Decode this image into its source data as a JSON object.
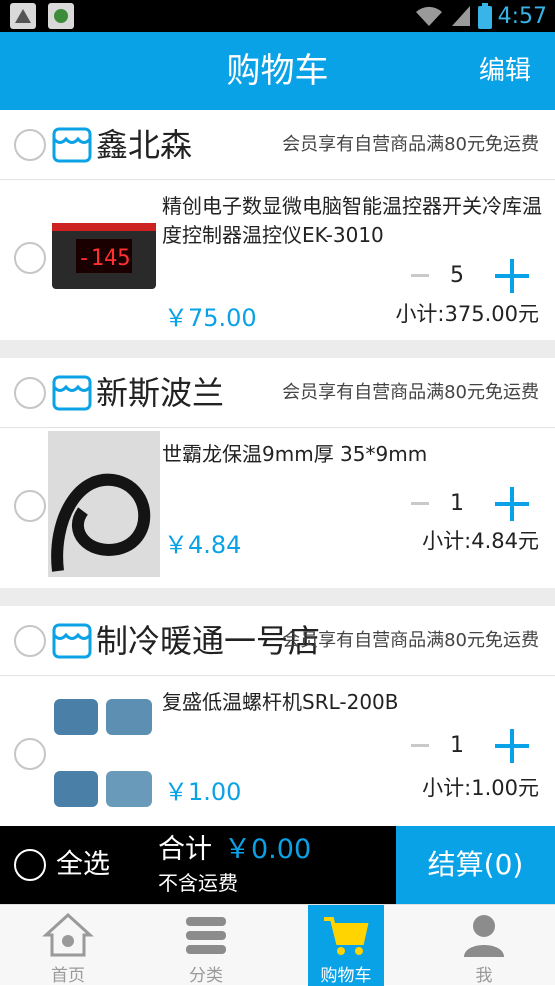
{
  "status_bar": {
    "time": "4:57"
  },
  "header": {
    "title": "购物车",
    "edit_label": "编辑"
  },
  "shops": [
    {
      "name": "鑫北森",
      "promo": "会员享有自营商品满80元免运费",
      "product": {
        "title": "精创电子数显微电脑智能温控器开关冷库温度控制器温控仪EK-3010",
        "image_icon": "temperature-controller-image",
        "display_text": "-145",
        "quantity": "5",
        "price": "￥75.00",
        "subtotal": "小计:375.00元"
      }
    },
    {
      "name": "新斯波兰",
      "promo": "会员享有自营商品满80元免运费",
      "product": {
        "title": "世霸龙保温9mm厚  35*9mm",
        "image_icon": "insulation-tube-image",
        "quantity": "1",
        "price": "￥4.84",
        "subtotal": "小计:4.84元"
      }
    },
    {
      "name": "制冷暖通一号店",
      "promo": "会员享有自营商品满80元免运费",
      "product": {
        "title": "复盛低温螺杆机SRL-200B",
        "image_icon": "screw-compressor-image",
        "quantity": "1",
        "price": "￥1.00",
        "subtotal": "小计:1.00元"
      }
    }
  ],
  "checkout": {
    "select_all": "全选",
    "total_label": "合计",
    "total_amount": "￥0.00",
    "shipping_note": "不含运费",
    "checkout_button": "结算(0)"
  },
  "tabs": [
    {
      "label": "首页",
      "icon": "home-icon",
      "active": false
    },
    {
      "label": "分类",
      "icon": "category-icon",
      "active": false
    },
    {
      "label": "购物车",
      "icon": "cart-icon",
      "active": true
    },
    {
      "label": "我",
      "icon": "profile-icon",
      "active": false
    }
  ],
  "colors": {
    "accent": "#0aa2e6",
    "checkout_bar": "#000000",
    "divider": "#ececec"
  }
}
